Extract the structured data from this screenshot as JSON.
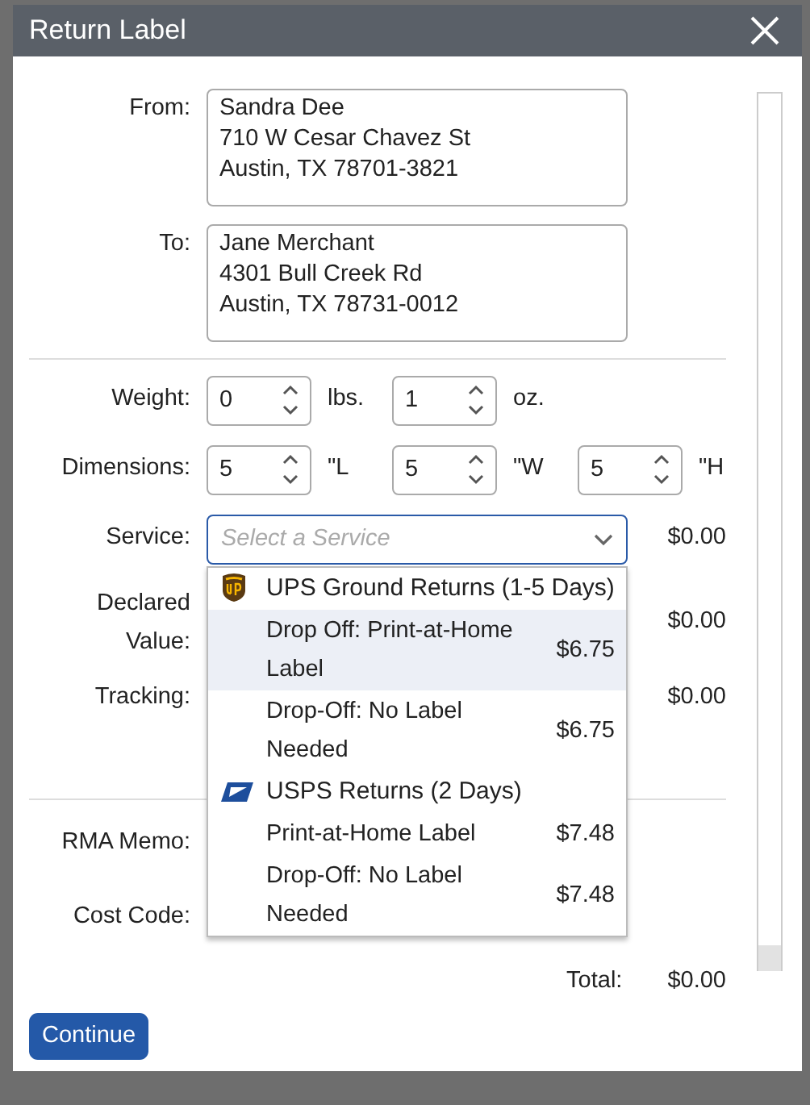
{
  "dialog": {
    "title": "Return Label"
  },
  "from": {
    "label": "From:",
    "lines": [
      "Sandra Dee",
      "710 W Cesar Chavez St",
      "Austin, TX 78701-3821"
    ]
  },
  "to": {
    "label": "To:",
    "lines": [
      "Jane Merchant",
      "4301 Bull Creek Rd",
      "Austin, TX 78731-0012"
    ]
  },
  "weight": {
    "label": "Weight:",
    "fields": [
      {
        "value": "0",
        "unit": "lbs."
      },
      {
        "value": "1",
        "unit": "oz."
      }
    ]
  },
  "dimensions": {
    "label": "Dimensions:",
    "fields": [
      {
        "value": "5",
        "unit": "\"L"
      },
      {
        "value": "5",
        "unit": "\"W"
      },
      {
        "value": "5",
        "unit": "\"H"
      }
    ]
  },
  "service": {
    "label": "Service:",
    "placeholder": "Select a Service",
    "price": "$0.00",
    "expanded": true
  },
  "declared_value": {
    "label": "Declared Value:",
    "price": "$0.00"
  },
  "tracking": {
    "label": "Tracking:",
    "price": "$0.00"
  },
  "rma_memo": {
    "label": "RMA Memo:"
  },
  "cost_code": {
    "label": "Cost Code:"
  },
  "total": {
    "label": "Total:",
    "value": "$0.00"
  },
  "dropdown": [
    {
      "kind": "group",
      "label": "UPS Ground Returns (1-5 Days)"
    },
    {
      "kind": "option",
      "label": "Drop Off: Print-at-Home Label",
      "price": "$6.75",
      "selected": true
    },
    {
      "kind": "option",
      "label": "Drop-Off: No Label Needed",
      "price": "$6.75",
      "selected": false
    },
    {
      "kind": "group",
      "label": "USPS Returns (2 Days)"
    },
    {
      "kind": "option",
      "label": "Print-at-Home Label",
      "price": "$7.48",
      "selected": false
    },
    {
      "kind": "option",
      "label": "Drop-Off: No Label Needed",
      "price": "$7.48",
      "selected": false
    }
  ],
  "buttons": [
    {
      "label": "Continue"
    }
  ]
}
